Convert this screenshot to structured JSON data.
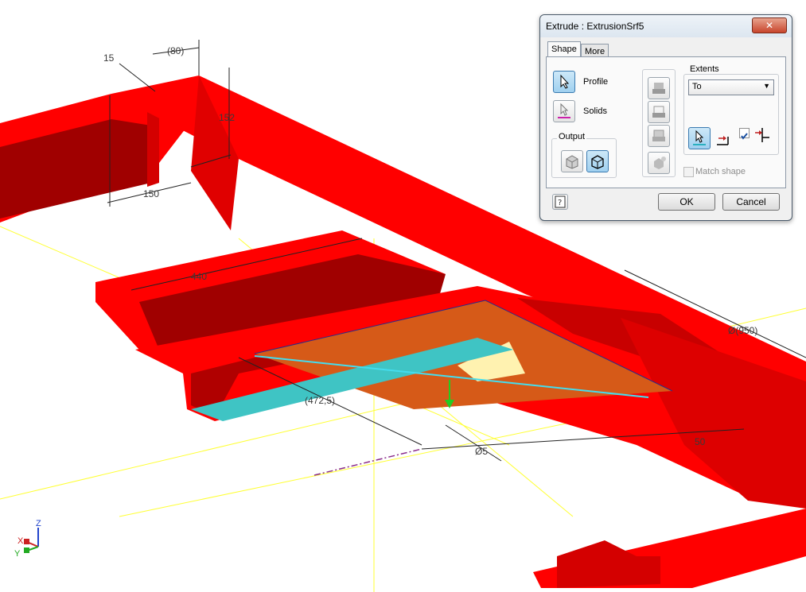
{
  "viewport": {
    "dimensions": [
      "15",
      "(80)",
      "152",
      "150",
      "440",
      "(472,5)",
      "Ø(950)",
      "50",
      "Ø5"
    ],
    "axes": {
      "x": "X",
      "y": "Y",
      "z": "Z"
    }
  },
  "dialog": {
    "title": "Extrude : ExtrusionSrf5",
    "close_icon": "close-icon",
    "tabs": [
      "Shape",
      "More"
    ],
    "profile_label": "Profile",
    "solids_label": "Solids",
    "output_label": "Output",
    "extents_label": "Extents",
    "extents_value": "To",
    "match_shape_label": "Match shape",
    "ok_label": "OK",
    "cancel_label": "Cancel",
    "help_icon": "help-icon"
  },
  "colors": {
    "part_red": "#ff0000",
    "part_shadow": "#a00000",
    "profile_cyan": "#3fc4c4",
    "profile_orange": "#d65a18",
    "selection_blue": "#9fd0ef"
  }
}
